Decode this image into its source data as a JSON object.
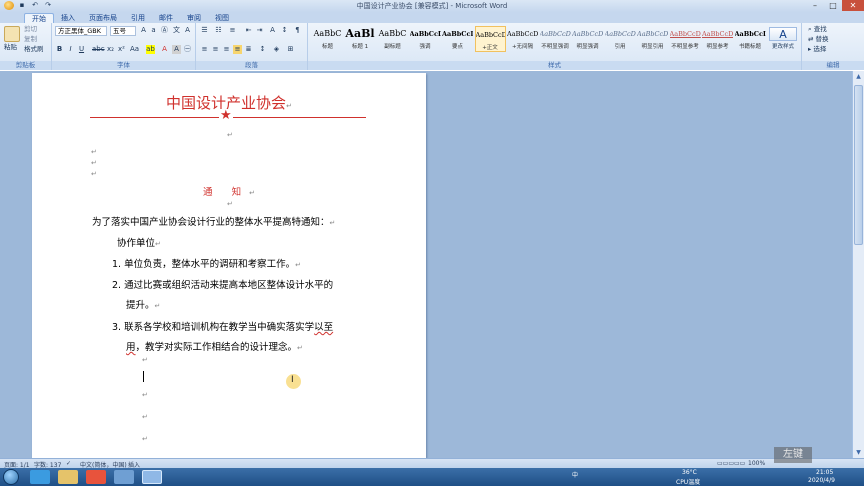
{
  "window": {
    "title": "中国设计产业协会 [兼容模式] - Microsoft Word",
    "controls": [
      "–",
      "□",
      "✕"
    ]
  },
  "tabs": [
    "开始",
    "插入",
    "页面布局",
    "引用",
    "邮件",
    "审阅",
    "视图"
  ],
  "ribbon": {
    "clipboard": {
      "paste": "粘贴",
      "cut": "剪切",
      "copy": "复制",
      "format_painter": "格式刷",
      "label": "剪贴板"
    },
    "font": {
      "name": "方正黑体_GBK",
      "size": "五号",
      "label": "字体"
    },
    "paragraph": {
      "label": "段落"
    },
    "styles": {
      "items": [
        {
          "sample": "AaBbC",
          "name": "标题"
        },
        {
          "sample": "AaBl",
          "name": "标题 1"
        },
        {
          "sample": "AaBbC",
          "name": "副标题"
        },
        {
          "sample": "AaBbCcD",
          "name": "强调"
        },
        {
          "sample": "AaBbCcD",
          "name": "要点"
        },
        {
          "sample": "AaBbCcDc",
          "name": "+正文"
        },
        {
          "sample": "AaBbCcDc",
          "name": "+无间隔"
        },
        {
          "sample": "AaBbCcDc",
          "name": "不明显强调"
        },
        {
          "sample": "AaBbCcDc",
          "name": "明显强调"
        },
        {
          "sample": "AaBbCcDc",
          "name": "引用"
        },
        {
          "sample": "AaBbCcDc",
          "name": "明显引用"
        },
        {
          "sample": "AaBbCcD",
          "name": "不明显参考"
        },
        {
          "sample": "AaBbCcD",
          "name": "明显参考"
        },
        {
          "sample": "AaBbCcI",
          "name": "书籍标题"
        }
      ],
      "change_styles": "更改样式",
      "label": "样式"
    },
    "editing": {
      "find": "查找",
      "replace": "替换",
      "select": "选择",
      "label": "编辑"
    }
  },
  "document": {
    "title": "中国设计产业协会",
    "notice_title": "通 知",
    "intro": "为了落实中国产业协会设计行业的整体水平提高特通知：",
    "org": "协作单位",
    "items": [
      {
        "num": "1.",
        "text": "单位负责，整体水平的调研和考察工作。"
      },
      {
        "num": "2.",
        "text": "通过比赛或组织活动来提高本地区整体设计水平的",
        "cont": "提升。"
      },
      {
        "num": "3.",
        "text_a": "联系各学校和培训机构在教学当中确实落实学",
        "text_b": "以至",
        "cont_a": "用",
        "cont_b": "，教学对实际工作相结合的设计理念。"
      }
    ],
    "para_mark": "↵",
    "star": "★"
  },
  "status": {
    "page": "页面: 1/1",
    "words": "字数: 137",
    "language": "中文(简体，中国)",
    "insert": "插入",
    "zoom": "100%"
  },
  "watermark": "左键",
  "taskbar": {
    "temp": "36°C",
    "cpu": "CPU温度",
    "time": "21:05",
    "date": "2020/4/9",
    "ime": "中"
  }
}
